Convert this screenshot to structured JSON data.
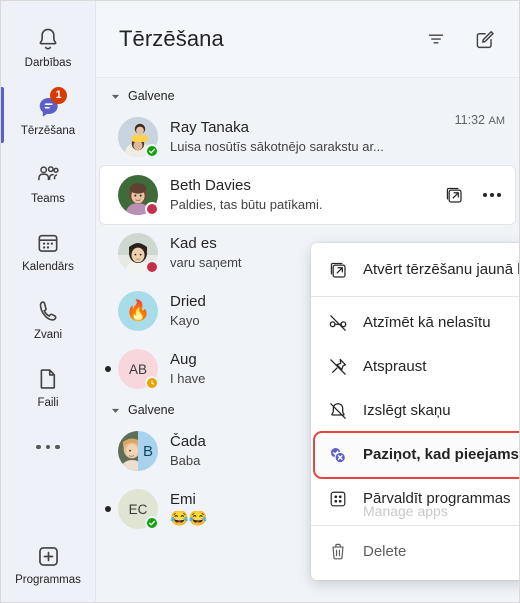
{
  "rail": {
    "items": [
      {
        "label": "Darbības",
        "icon": "bell-icon",
        "active": false,
        "badge": ""
      },
      {
        "label": "Tērzēšana",
        "icon": "chat-icon",
        "active": true,
        "badge": "1"
      },
      {
        "label": "Teams",
        "icon": "teams-icon",
        "active": false,
        "badge": ""
      },
      {
        "label": "Kalendārs",
        "icon": "calendar-icon",
        "active": false,
        "badge": ""
      },
      {
        "label": "Zvani",
        "icon": "phone-icon",
        "active": false,
        "badge": ""
      },
      {
        "label": "Faili",
        "icon": "file-icon",
        "active": false,
        "badge": ""
      }
    ],
    "more_label": "more-icon",
    "apps": {
      "label": "Programmas",
      "icon": "plus-box-icon"
    },
    "accent_color": "#5b5fc7",
    "badge_color": "#d83b01"
  },
  "header": {
    "title": "Tērzēšana",
    "filter_icon": "filter-icon",
    "compose_icon": "compose-icon"
  },
  "list": {
    "groups": [
      {
        "label": "Galvene",
        "rows": [
          {
            "name": "Ray Tanaka",
            "preview": "Luisa nosūtīs sākotnējo sarakstu ar...",
            "time": "11:32",
            "ampm": "AM",
            "avatar_kind": "photo-child",
            "initials": "",
            "presence": "available",
            "unread": false,
            "hovered": false
          },
          {
            "name": "Beth Davies",
            "preview": "Paldies, tas būtu patīkami.",
            "time": "",
            "ampm": "",
            "avatar_kind": "photo-woman",
            "initials": "",
            "presence": "busy",
            "unread": false,
            "hovered": true,
            "actions": {
              "popout_icon": "open-in-new-window-icon",
              "more_icon": "more-options-icon"
            }
          },
          {
            "name": "Kad es",
            "preview": "varu saņemt",
            "time": "",
            "ampm": "",
            "avatar_kind": "photo-woman2",
            "initials": "",
            "presence": "busy",
            "unread": false,
            "hovered": false
          },
          {
            "name": "Dried",
            "preview": "Kayo",
            "time": "",
            "ampm": "",
            "avatar_kind": "emoji-fire",
            "initials": "🔥",
            "presence": "",
            "unread": false,
            "hovered": false
          },
          {
            "name": "Aug",
            "preview": "I have",
            "time": "",
            "ampm": "",
            "avatar_kind": "initials-pink",
            "initials": "AB",
            "presence": "away",
            "unread": true,
            "hovered": false
          }
        ]
      },
      {
        "label": "Galvene",
        "rows": [
          {
            "name": "Čada",
            "preview": "Baba",
            "time": "",
            "ampm": "",
            "avatar_kind": "split-photo-b",
            "initials": "B",
            "presence": "",
            "unread": false,
            "hovered": false
          },
          {
            "name": "Emi",
            "preview": "😂😂",
            "time": "",
            "ampm": "",
            "avatar_kind": "initials-green",
            "initials": "EC",
            "presence": "available",
            "unread": true,
            "hovered": false
          }
        ]
      }
    ]
  },
  "context_menu": {
    "items": [
      {
        "label": "Atvērt tērzēšanu jaunā logā",
        "icon": "open-in-new-window-icon",
        "highlight": false,
        "muted": false,
        "ghost": ""
      },
      {
        "label": "Atzīmēt kā nelasītu",
        "icon": "mark-unread-icon",
        "highlight": false,
        "muted": false,
        "ghost": ""
      },
      {
        "label": "Atspraust",
        "icon": "unpin-icon",
        "highlight": false,
        "muted": false,
        "ghost": ""
      },
      {
        "label": "Izslēgt skaņu",
        "icon": "mute-icon",
        "highlight": false,
        "muted": false,
        "ghost": ""
      },
      {
        "label": "Paziņot, kad pieejams",
        "icon": "notify-when-available-icon",
        "highlight": true,
        "muted": false,
        "ghost": ""
      },
      {
        "label": "Pārvaldīt programmas",
        "icon": "manage-apps-icon",
        "highlight": false,
        "muted": false,
        "ghost": "Manage apps"
      },
      {
        "label": "Delete",
        "icon": "trash-icon",
        "highlight": false,
        "muted": true,
        "ghost": ""
      }
    ],
    "highlight_color": "#e8443a",
    "separator_after": [
      0,
      5
    ]
  }
}
